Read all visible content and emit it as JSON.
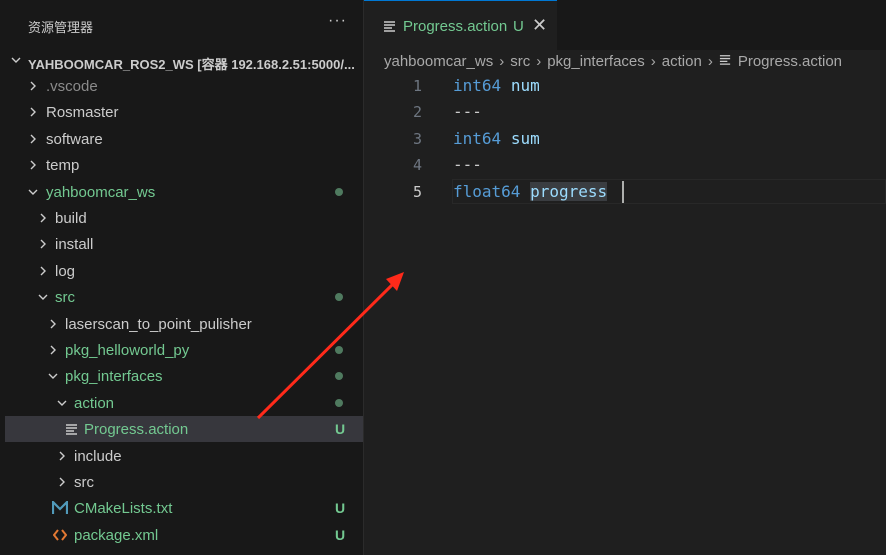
{
  "sidebar": {
    "title": "资源管理器",
    "more_icon": "ellipsis-icon",
    "tree": [
      {
        "label": "YAHBOOMCAR_ROS2_WS [容器 192.168.2.51:5000/...",
        "expanded": true
      },
      {
        "label": ".vscode",
        "expanded": false
      },
      {
        "label": "Rosmaster",
        "expanded": false
      },
      {
        "label": "software",
        "expanded": false
      },
      {
        "label": "temp",
        "expanded": false
      },
      {
        "label": "yahboomcar_ws",
        "expanded": true,
        "status": "modified-dot"
      },
      {
        "label": "build",
        "expanded": false
      },
      {
        "label": "install",
        "expanded": false
      },
      {
        "label": "log",
        "expanded": false
      },
      {
        "label": "src",
        "expanded": true,
        "status": "modified-dot"
      },
      {
        "label": "laserscan_to_point_pulisher",
        "expanded": false
      },
      {
        "label": "pkg_helloworld_py",
        "expanded": false,
        "status": "modified-dot"
      },
      {
        "label": "pkg_interfaces",
        "expanded": true,
        "status": "modified-dot"
      },
      {
        "label": "action",
        "expanded": true,
        "status": "modified-dot"
      },
      {
        "label": "Progress.action",
        "badge": "U",
        "selected": true
      },
      {
        "label": "include",
        "expanded": false
      },
      {
        "label": "src",
        "expanded": false
      },
      {
        "label": "CMakeLists.txt",
        "badge": "U"
      },
      {
        "label": "package.xml",
        "badge": "U"
      }
    ]
  },
  "tab": {
    "label": "Progress.action",
    "badge": "U",
    "close": "✕"
  },
  "breadcrumb": [
    "yahboomcar_ws",
    "src",
    "pkg_interfaces",
    "action",
    "Progress.action"
  ],
  "editor": {
    "lines": [
      {
        "no": "1",
        "type": "int64",
        "name": "num"
      },
      {
        "no": "2",
        "text": "---"
      },
      {
        "no": "3",
        "type": "int64",
        "name": "sum"
      },
      {
        "no": "4",
        "text": "---"
      },
      {
        "no": "5",
        "type": "float64",
        "name": "progress"
      }
    ],
    "current_line": 5
  },
  "colors": {
    "accent": "#0078d4",
    "untracked": "#73c991",
    "keyword": "#569cd6",
    "identifier": "#9cdcfe",
    "arrow": "#ff2a1a"
  }
}
